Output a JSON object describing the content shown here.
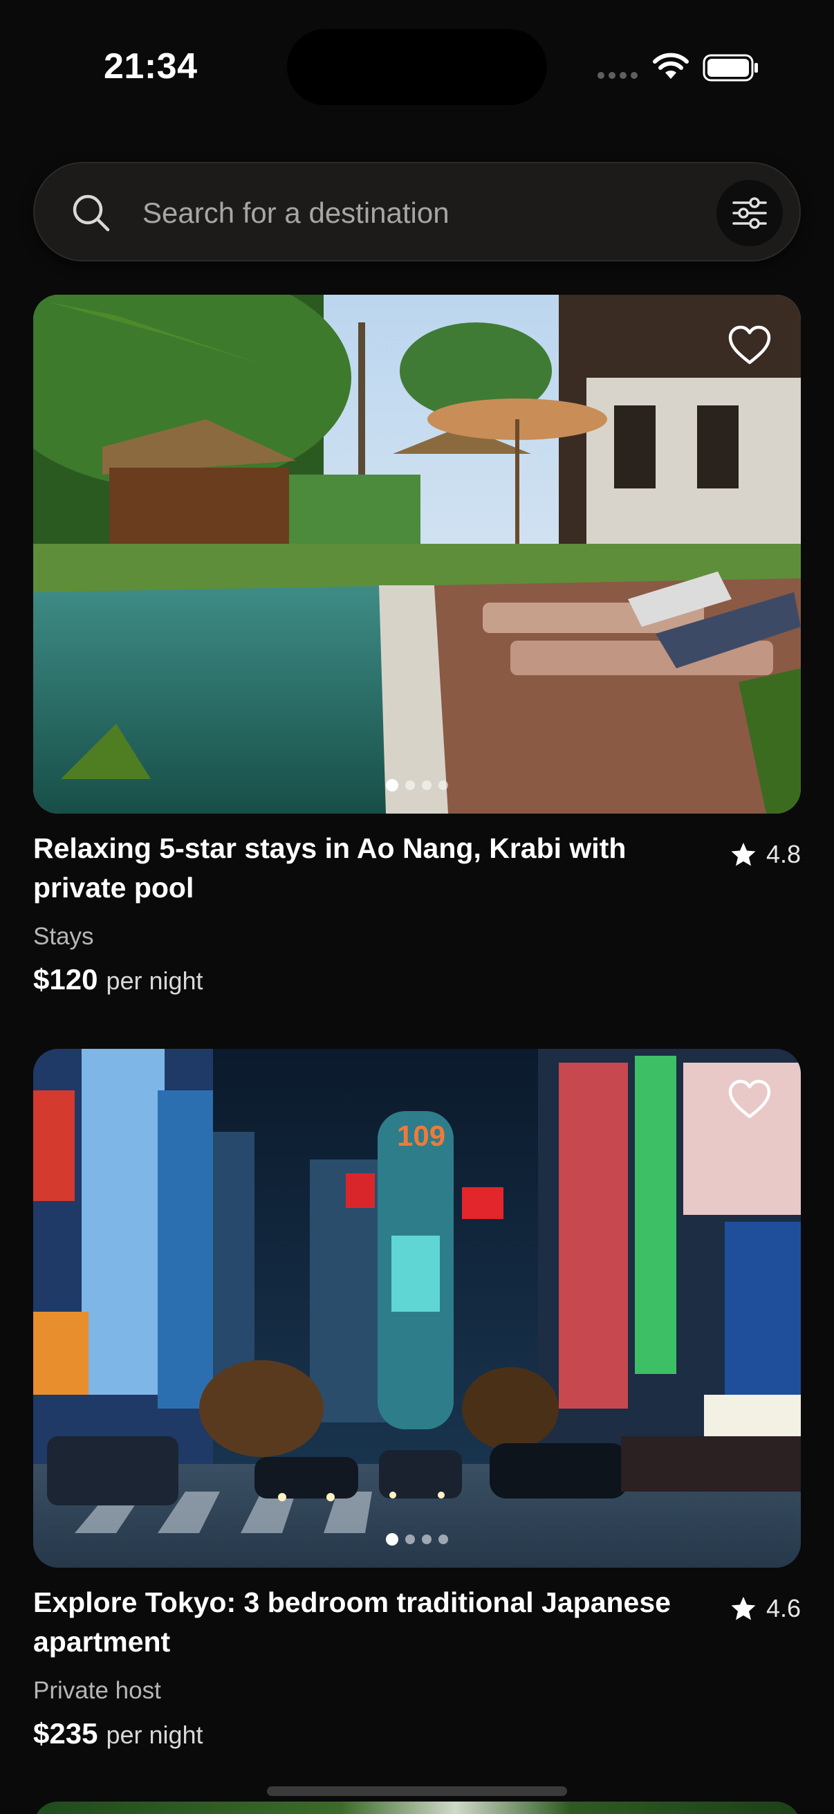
{
  "status_bar": {
    "time": "21:34"
  },
  "search": {
    "placeholder": "Search for a destination",
    "icon": "search-icon",
    "filter_icon": "sliders-icon"
  },
  "listings": [
    {
      "title": "Relaxing 5-star stays in Ao Nang, Krabi with private pool",
      "rating": "4.8",
      "category": "Stays",
      "price": "$120",
      "price_unit": "per night",
      "image_page_count": 4,
      "image_active_page": 1,
      "favorited": false
    },
    {
      "title": "Explore Tokyo: 3 bedroom traditional Japanese apartment",
      "rating": "4.6",
      "category": "Private host",
      "price": "$235",
      "price_unit": "per night",
      "image_page_count": 4,
      "image_active_page": 1,
      "favorited": false
    }
  ],
  "colors": {
    "background": "#0a0a0a",
    "search_bg": "#1d1b1a",
    "text_primary": "#ffffff",
    "text_secondary": "#b6b6b6"
  }
}
